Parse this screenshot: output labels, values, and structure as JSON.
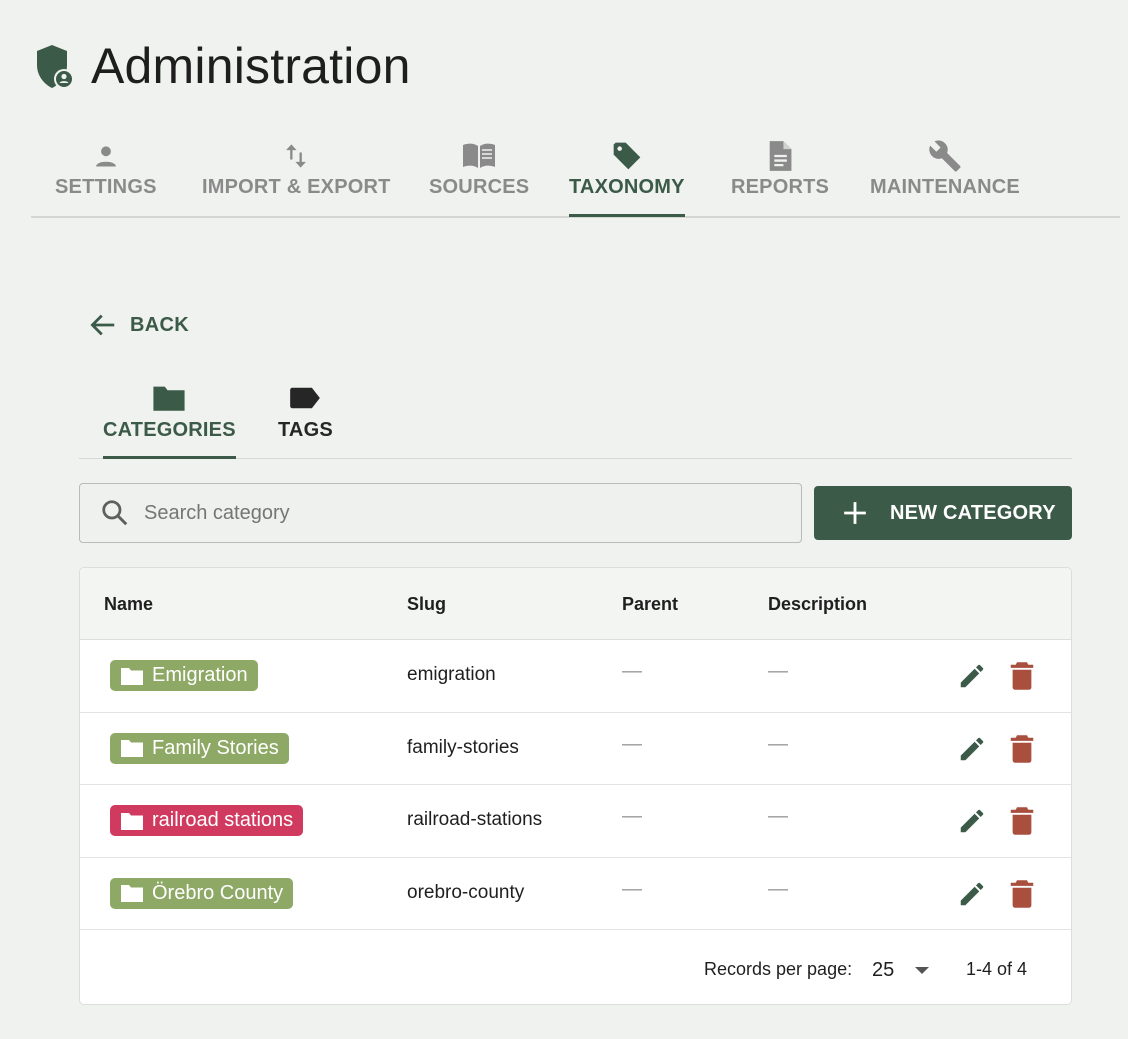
{
  "header": {
    "title": "Administration"
  },
  "main_tabs": [
    {
      "label": "SETTINGS",
      "icon": "person-icon"
    },
    {
      "label": "IMPORT & EXPORT",
      "icon": "swap-vertical-icon"
    },
    {
      "label": "SOURCES",
      "icon": "book-icon"
    },
    {
      "label": "TAXONOMY",
      "icon": "tag-icon",
      "active": true
    },
    {
      "label": "REPORTS",
      "icon": "document-icon"
    },
    {
      "label": "MAINTENANCE",
      "icon": "wrench-icon"
    }
  ],
  "back": {
    "label": "BACK"
  },
  "sub_tabs": [
    {
      "label": "CATEGORIES",
      "icon": "folder-icon",
      "active": true
    },
    {
      "label": "TAGS",
      "icon": "tag-label-icon"
    }
  ],
  "search": {
    "placeholder": "Search category",
    "value": ""
  },
  "new_button": {
    "label": "NEW CATEGORY"
  },
  "table": {
    "headers": {
      "name": "Name",
      "slug": "Slug",
      "parent": "Parent",
      "description": "Description"
    },
    "rows": [
      {
        "name": "Emigration",
        "slug": "emigration",
        "parent": "—",
        "description": "—",
        "color": "#8ea866"
      },
      {
        "name": "Family Stories",
        "slug": "family-stories",
        "parent": "—",
        "description": "—",
        "color": "#8ea866"
      },
      {
        "name": "railroad stations",
        "slug": "railroad-stations",
        "parent": "—",
        "description": "—",
        "color": "#d13a5f"
      },
      {
        "name": "Örebro County",
        "slug": "orebro-county",
        "parent": "—",
        "description": "—",
        "color": "#8ea866"
      }
    ]
  },
  "pagination": {
    "records_per_page_label": "Records per page:",
    "records_per_page": "25",
    "range": "1-4 of 4"
  },
  "colors": {
    "primary": "#3c5a48",
    "delete": "#a84f3e",
    "edit": "#3c5a48",
    "background": "#eff2ef"
  }
}
